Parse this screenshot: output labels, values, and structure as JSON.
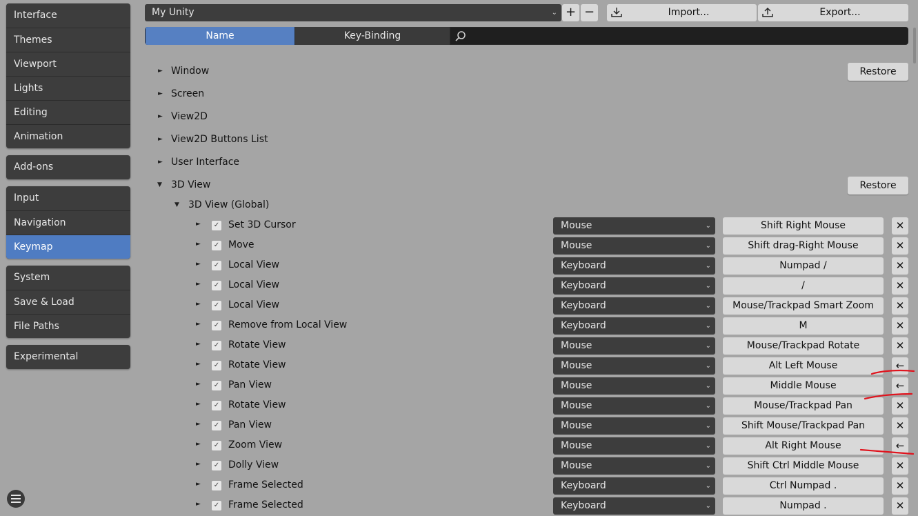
{
  "sidebar": {
    "group1": [
      "Interface",
      "Themes",
      "Viewport",
      "Lights",
      "Editing",
      "Animation"
    ],
    "group2": [
      "Add-ons"
    ],
    "group3": [
      "Input",
      "Navigation",
      "Keymap"
    ],
    "group4": [
      "System",
      "Save & Load",
      "File Paths"
    ],
    "group5": [
      "Experimental"
    ],
    "active": "Keymap"
  },
  "header": {
    "preset_value": "My Unity",
    "add_symbol": "+",
    "remove_symbol": "−",
    "import_label": "Import...",
    "export_label": "Export..."
  },
  "search": {
    "tab_name": "Name",
    "tab_keybinding": "Key-Binding",
    "active_tab": "Name",
    "query": ""
  },
  "tree": {
    "restore_label": "Restore",
    "categories": [
      "Window",
      "Screen",
      "View2D",
      "View2D Buttons List",
      "User Interface",
      "3D View"
    ],
    "subcategory": "3D View (Global)",
    "items": [
      {
        "name": "Set 3D Cursor",
        "device": "Mouse",
        "key": "Shift Right Mouse",
        "action": "✕"
      },
      {
        "name": "Move",
        "device": "Mouse",
        "key": "Shift drag-Right Mouse",
        "action": "✕"
      },
      {
        "name": "Local View",
        "device": "Keyboard",
        "key": "Numpad /",
        "action": "✕"
      },
      {
        "name": "Local View",
        "device": "Keyboard",
        "key": "/",
        "action": "✕"
      },
      {
        "name": "Local View",
        "device": "Keyboard",
        "key": "Mouse/Trackpad Smart Zoom",
        "action": "✕"
      },
      {
        "name": "Remove from Local View",
        "device": "Keyboard",
        "key": "M",
        "action": "✕"
      },
      {
        "name": "Rotate View",
        "device": "Mouse",
        "key": "Mouse/Trackpad Rotate",
        "action": "✕"
      },
      {
        "name": "Rotate View",
        "device": "Mouse",
        "key": "Alt Left Mouse",
        "action": "←"
      },
      {
        "name": "Pan View",
        "device": "Mouse",
        "key": "Middle Mouse",
        "action": "←"
      },
      {
        "name": "Rotate View",
        "device": "Mouse",
        "key": "Mouse/Trackpad Pan",
        "action": "✕"
      },
      {
        "name": "Pan View",
        "device": "Mouse",
        "key": "Shift Mouse/Trackpad Pan",
        "action": "✕"
      },
      {
        "name": "Zoom View",
        "device": "Mouse",
        "key": "Alt Right Mouse",
        "action": "←"
      },
      {
        "name": "Dolly View",
        "device": "Mouse",
        "key": "Shift Ctrl Middle Mouse",
        "action": "✕"
      },
      {
        "name": "Frame Selected",
        "device": "Keyboard",
        "key": "Ctrl Numpad .",
        "action": "✕"
      },
      {
        "name": "Frame Selected",
        "device": "Keyboard",
        "key": "Numpad .",
        "action": "✕"
      }
    ]
  },
  "colors": {
    "background": "#a5a5a5",
    "panel": "#3d3d3d",
    "accent": "#5680c2",
    "button": "#d9d9d9",
    "annotation": "#e0141e"
  }
}
